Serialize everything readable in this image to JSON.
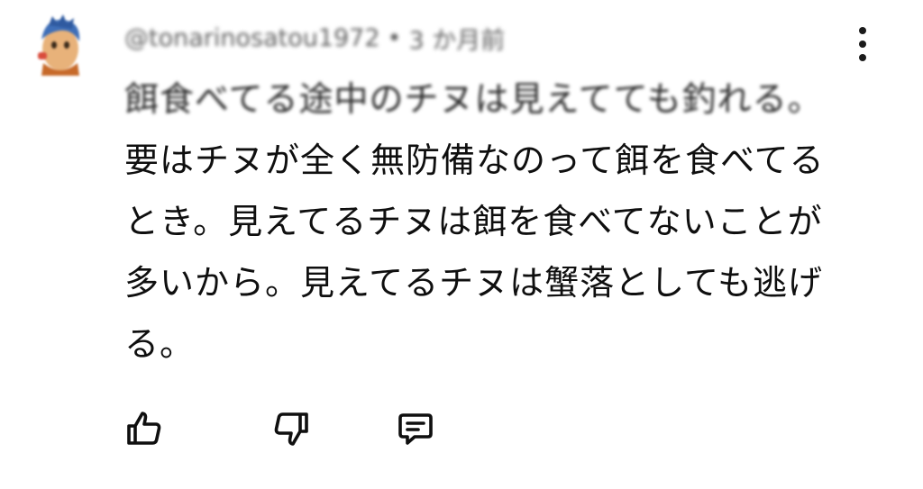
{
  "comment": {
    "author": "@tonarinosatou1972",
    "separator": "•",
    "timestamp": "3 か月前",
    "text_line1": "餌食べてる途中のチヌは見えてても釣れる。",
    "text_rest": "要はチヌが全く無防備なのって餌を食べてるとき。見えてるチヌは餌を食べてないことが多いから。見えてるチヌは蟹落としても逃げる。"
  },
  "icons": {
    "avatar": "avatar-image",
    "menu": "more-vert-icon",
    "like": "thumbs-up-icon",
    "dislike": "thumbs-down-icon",
    "reply": "reply-comment-icon"
  }
}
